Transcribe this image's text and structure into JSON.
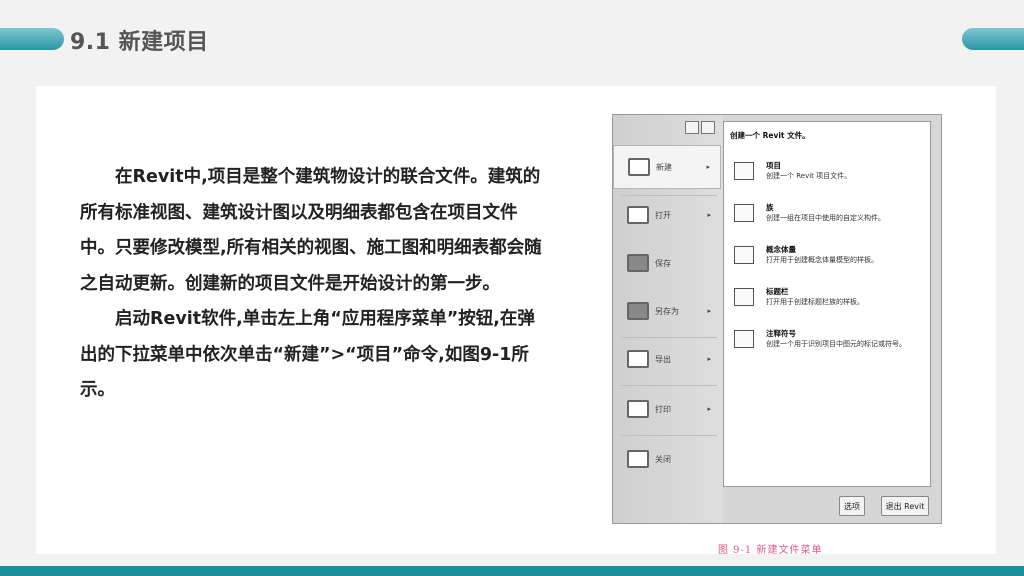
{
  "slide": {
    "title": "9.1 新建项目",
    "paragraph1": "在Revit中,项目是整个建筑物设计的联合文件。建筑的所有标准视图、建筑设计图以及明细表都包含在项目文件中。只要修改模型,所有相关的视图、施工图和明细表都会随之自动更新。创建新的项目文件是开始设计的第一步。",
    "paragraph2": "启动Revit软件,单击左上角“应用程序菜单”按钮,在弹出的下拉菜单中依次单击“新建”>“项目”命令,如图9-1所示。",
    "caption": "图 9-1   新建文件菜单"
  },
  "menu": {
    "left_items": [
      {
        "label": "新建",
        "icon": "new-file-icon",
        "arrow": "▸"
      },
      {
        "label": "打开",
        "icon": "open-folder-icon",
        "arrow": "▸"
      },
      {
        "label": "保存",
        "icon": "save-disk-icon",
        "arrow": ""
      },
      {
        "label": "另存为",
        "icon": "save-as-icon",
        "arrow": "▸"
      },
      {
        "label": "导出",
        "icon": "export-icon",
        "arrow": "▸"
      },
      {
        "label": "打印",
        "icon": "printer-icon",
        "arrow": "▸"
      },
      {
        "label": "关闭",
        "icon": "close-file-icon",
        "arrow": ""
      }
    ],
    "sub_header": "创建一个 Revit 文件。",
    "sub_items": [
      {
        "title": "项目",
        "desc": "创建一个 Revit 项目文件。",
        "icon": "project-icon"
      },
      {
        "title": "族",
        "desc": "创建一组在项目中使用的自定义构件。",
        "icon": "family-icon"
      },
      {
        "title": "概念体量",
        "desc": "打开用于创建概念体量模型的样板。",
        "icon": "conceptual-mass-icon"
      },
      {
        "title": "标题栏",
        "desc": "打开用于创建标题栏族的样板。",
        "icon": "title-block-icon"
      },
      {
        "title": "注释符号",
        "desc": "创建一个用于识别项目中图元的标记或符号。",
        "icon": "annotation-symbol-icon"
      }
    ],
    "options_button": "选项",
    "exit_button": "退出 Revit"
  },
  "colors": {
    "accent": "#1c8e9c",
    "caption": "#e05a8a"
  }
}
